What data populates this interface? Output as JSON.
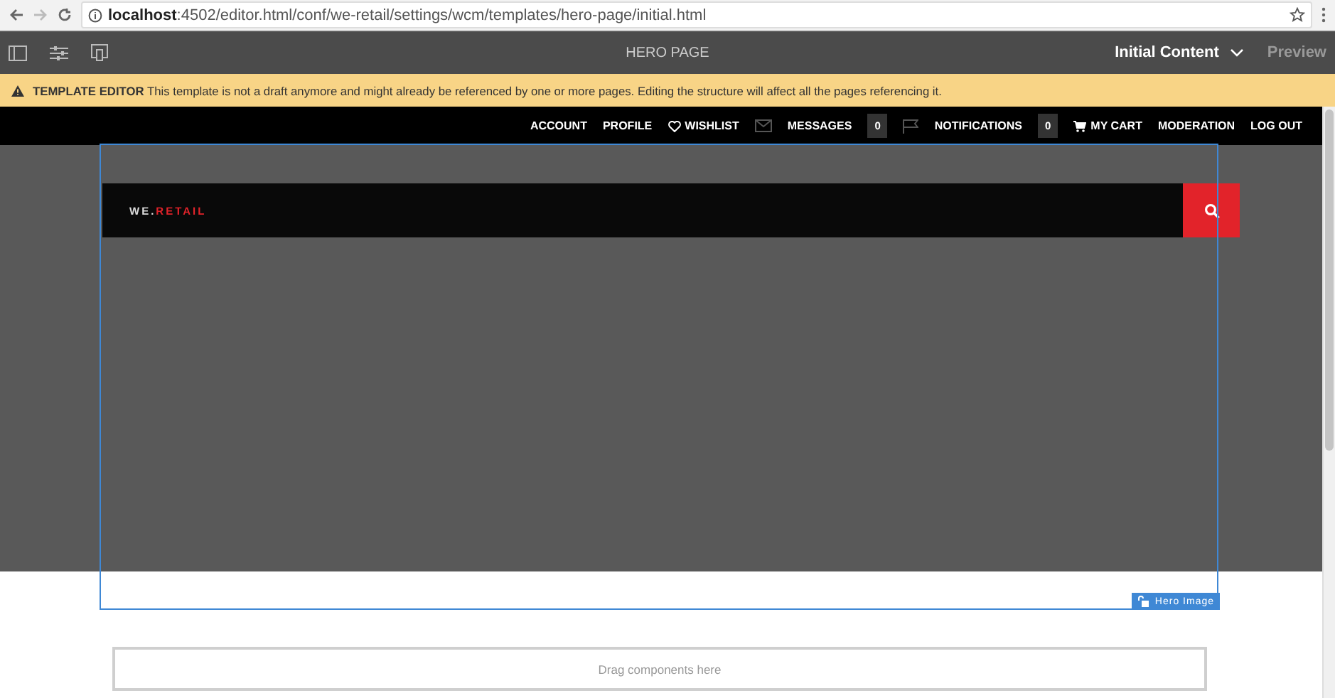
{
  "browser": {
    "url_host": "localhost",
    "url_rest": ":4502/editor.html/conf/we-retail/settings/wcm/templates/hero-page/initial.html"
  },
  "toolbar": {
    "title": "HERO PAGE",
    "mode": "Initial Content",
    "preview": "Preview"
  },
  "banner": {
    "label": "TEMPLATE EDITOR",
    "message": "This template is not a draft anymore and might already be referenced by one or more pages. Editing the structure will affect all the pages referencing it."
  },
  "nav": [
    {
      "kind": "link",
      "label": "ACCOUNT"
    },
    {
      "kind": "link",
      "label": "PROFILE"
    },
    {
      "kind": "heart",
      "label": "WISHLIST"
    },
    {
      "kind": "mail",
      "label": "MESSAGES",
      "count": "0"
    },
    {
      "kind": "flag",
      "label": "NOTIFICATIONS",
      "count": "0"
    },
    {
      "kind": "cart",
      "label": "MY CART"
    },
    {
      "kind": "link",
      "label": "MODERATION"
    },
    {
      "kind": "link",
      "label": "LOG OUT"
    }
  ],
  "logo": {
    "prefix": "WE.",
    "name": "RETAIL"
  },
  "component_label": "Hero Image",
  "drop_zone": "Drag components here"
}
